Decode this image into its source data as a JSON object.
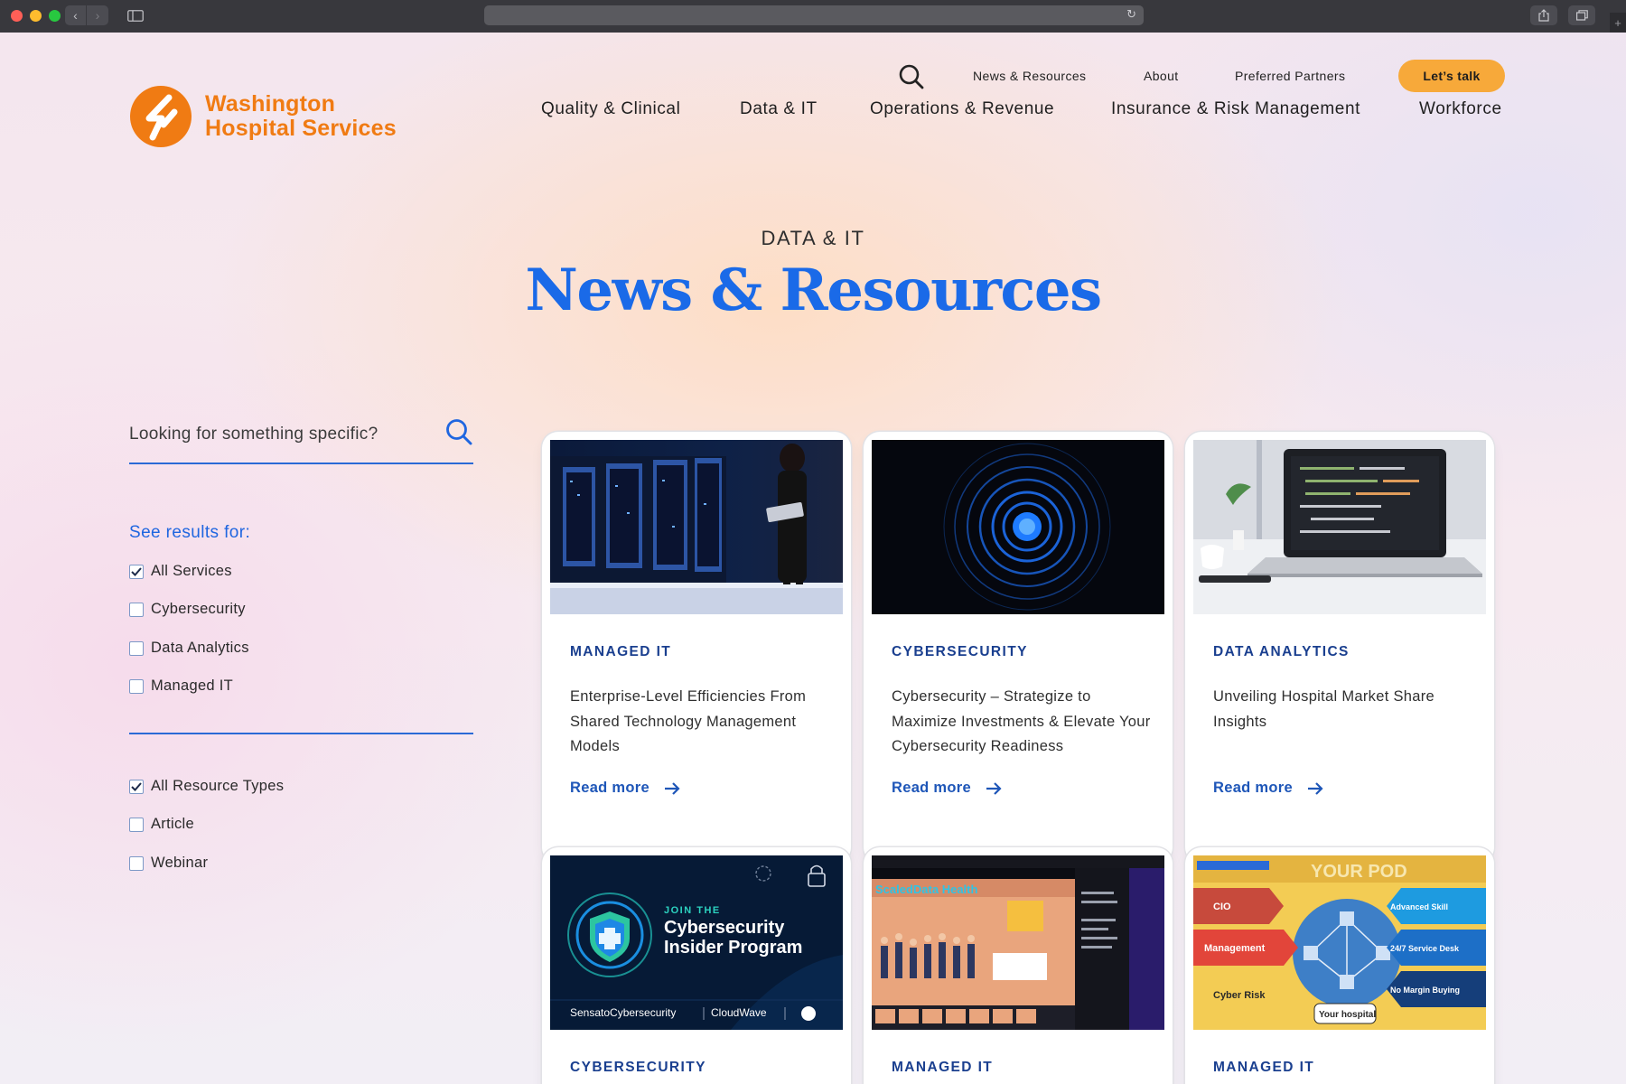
{
  "brand": {
    "name_line1": "Washington",
    "name_line2": "Hospital Services",
    "color": "#f07b13"
  },
  "util_nav": {
    "items": [
      "News & Resources",
      "About",
      "Preferred Partners"
    ],
    "cta_label": "Let’s talk",
    "search_icon": "search-icon"
  },
  "main_nav": {
    "items": [
      "Quality & Clinical",
      "Data & IT",
      "Operations & Revenue",
      "Insurance & Risk Management",
      "Workforce"
    ]
  },
  "hero": {
    "eyebrow": "DATA & IT",
    "title": "News & Resources"
  },
  "sidebar": {
    "search_placeholder": "Looking for something specific?",
    "results_heading": "See results for:",
    "service_filters": [
      {
        "label": "All Services",
        "checked": true
      },
      {
        "label": "Cybersecurity",
        "checked": false
      },
      {
        "label": "Data Analytics",
        "checked": false
      },
      {
        "label": "Managed IT",
        "checked": false
      }
    ],
    "type_filters": [
      {
        "label": "All Resource Types",
        "checked": true
      },
      {
        "label": "Article",
        "checked": false
      },
      {
        "label": "Webinar",
        "checked": false
      }
    ]
  },
  "cards": [
    {
      "category": "MANAGED IT",
      "title": "Enterprise-Level Efficiencies From Shared Technology Management Models",
      "link": "Read more"
    },
    {
      "category": "CYBERSECURITY",
      "title": "Cybersecurity – Strategize to Maximize Investments & Elevate Your Cybersecurity Readiness",
      "link": "Read more"
    },
    {
      "category": "DATA ANALYTICS",
      "title": "Unveiling Hospital Market Share Insights",
      "link": "Read more"
    },
    {
      "category": "CYBERSECURITY",
      "title": "",
      "link": ""
    },
    {
      "category": "MANAGED IT",
      "title": "",
      "link": ""
    },
    {
      "category": "MANAGED IT",
      "title": "",
      "link": ""
    }
  ],
  "card_images": {
    "promo_join": "JOIN THE",
    "promo_line1": "Cybersecurity",
    "promo_line2": "Insider Program",
    "promo_partner1": "SensatoCybersecurity",
    "promo_partner2": "CloudWave",
    "webinar_brand": "ScaledData Health",
    "pod_title": "YOUR POD",
    "pod_labels": [
      "CIO",
      "Management",
      "Cyber Risk",
      "Advanced Skill",
      "24/7 Service Desk",
      "No Margin Buying"
    ],
    "pod_center": "Your hospital"
  },
  "colors": {
    "accent_blue": "#1a6ae8",
    "cta_orange": "#f7a93a",
    "category_navy": "#1a3f8f"
  }
}
